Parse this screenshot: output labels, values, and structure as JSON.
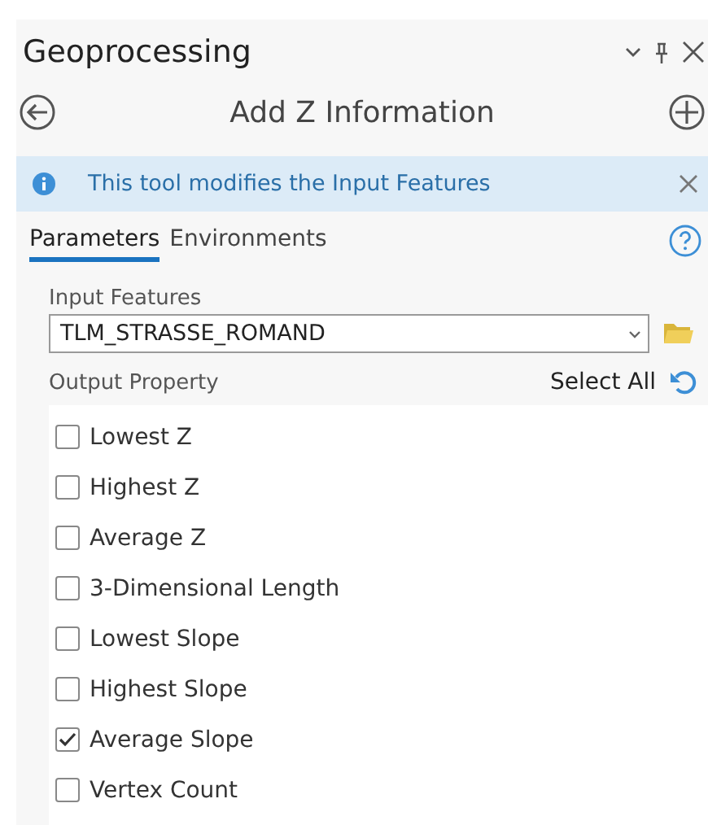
{
  "pane": {
    "title": "Geoprocessing"
  },
  "tool": {
    "title": "Add Z Information"
  },
  "banner": {
    "message": "This tool modifies the Input Features"
  },
  "tabs": [
    {
      "label": "Parameters",
      "selected": true
    },
    {
      "label": "Environments",
      "selected": false
    }
  ],
  "input_features": {
    "label": "Input Features",
    "value": "TLM_STRASSE_ROMAND"
  },
  "output_property": {
    "label": "Output Property",
    "select_all": "Select All",
    "options": [
      {
        "label": "Lowest Z",
        "checked": false
      },
      {
        "label": "Highest Z",
        "checked": false
      },
      {
        "label": "Average Z",
        "checked": false
      },
      {
        "label": "3-Dimensional Length",
        "checked": false
      },
      {
        "label": "Lowest Slope",
        "checked": false
      },
      {
        "label": "Highest Slope",
        "checked": false
      },
      {
        "label": "Average Slope",
        "checked": true
      },
      {
        "label": "Vertex Count",
        "checked": false
      }
    ]
  }
}
